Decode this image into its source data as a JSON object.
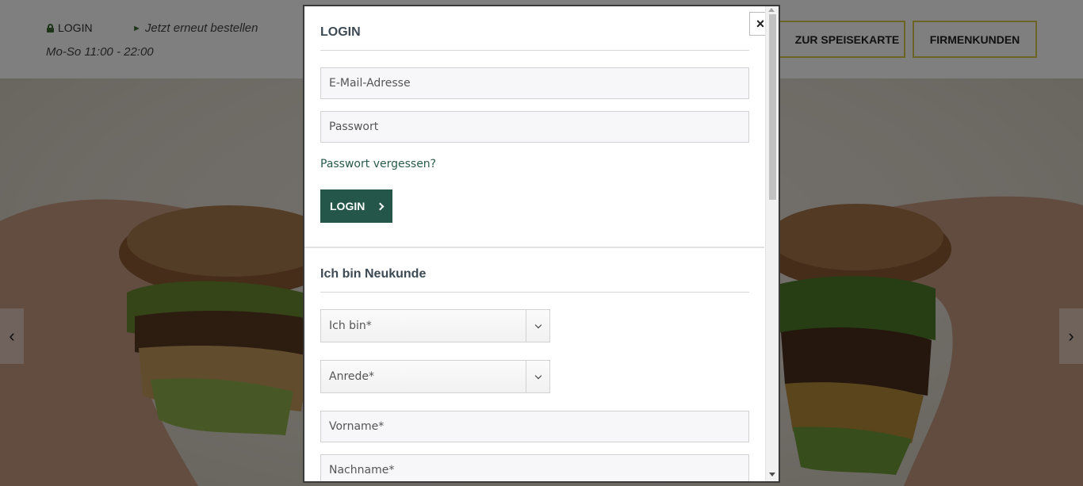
{
  "header": {
    "login_label": "LOGIN",
    "reorder_label": "Jetzt erneut bestellen",
    "hours": "Mo-So 11:00 - 22:00",
    "menu_button": "ZUR SPEISEKARTE",
    "business_button": "FIRMENKUNDEN"
  },
  "hero": {
    "prev_arrow": "‹",
    "next_arrow": "›"
  },
  "modal": {
    "close_label": "×",
    "login": {
      "title": "LOGIN",
      "email_placeholder": "E-Mail-Adresse",
      "password_placeholder": "Passwort",
      "forgot_link": "Passwort vergessen?",
      "submit_label": "LOGIN"
    },
    "register": {
      "title": "Ich bin Neukunde",
      "type_select": "Ich bin*",
      "salutation_select": "Anrede*",
      "firstname_placeholder": "Vorname*",
      "lastname_placeholder": "Nachname*"
    }
  },
  "colors": {
    "primary": "#24564a",
    "accent_border": "#d9c94a",
    "link": "#2a5a4c"
  }
}
